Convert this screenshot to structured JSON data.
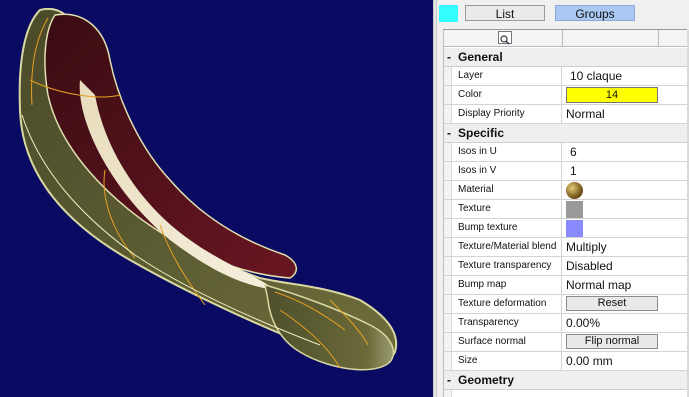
{
  "toolbar": {
    "swatch_color": "#33ffff",
    "list_label": "List",
    "groups_label": "Groups"
  },
  "header": {
    "search_icon": "magnifier-icon"
  },
  "groups": {
    "general": "General",
    "specific": "Specific",
    "geometry": "Geometry"
  },
  "props": {
    "layer": {
      "label": "Layer",
      "value": "10   claque"
    },
    "color": {
      "label": "Color",
      "value": "14",
      "swatch": "#ffff00"
    },
    "display_priority": {
      "label": "Display Priority",
      "value": "Normal"
    },
    "isos_u": {
      "label": "Isos in U",
      "value": "6"
    },
    "isos_v": {
      "label": "Isos in V",
      "value": "1"
    },
    "material": {
      "label": "Material",
      "icon": "material-sphere-icon"
    },
    "texture": {
      "label": "Texture",
      "swatch": "#9a9a9a"
    },
    "bump_texture": {
      "label": "Bump texture",
      "swatch": "#8a8aff"
    },
    "tex_mat_blend": {
      "label": "Texture/Material blend",
      "value": "Multiply"
    },
    "tex_transparency": {
      "label": "Texture transparency",
      "value": "Disabled"
    },
    "bump_map": {
      "label": "Bump map",
      "value": "Normal map"
    },
    "tex_deformation": {
      "label": "Texture deformation",
      "button": "Reset"
    },
    "transparency": {
      "label": "Transparency",
      "value": "0.00%"
    },
    "surface_normal": {
      "label": "Surface normal",
      "button": "Flip normal"
    },
    "size": {
      "label": "Size",
      "value": "0.00 mm"
    }
  },
  "viewport": {
    "background": "#0a0a62",
    "model": "shoe-model"
  }
}
